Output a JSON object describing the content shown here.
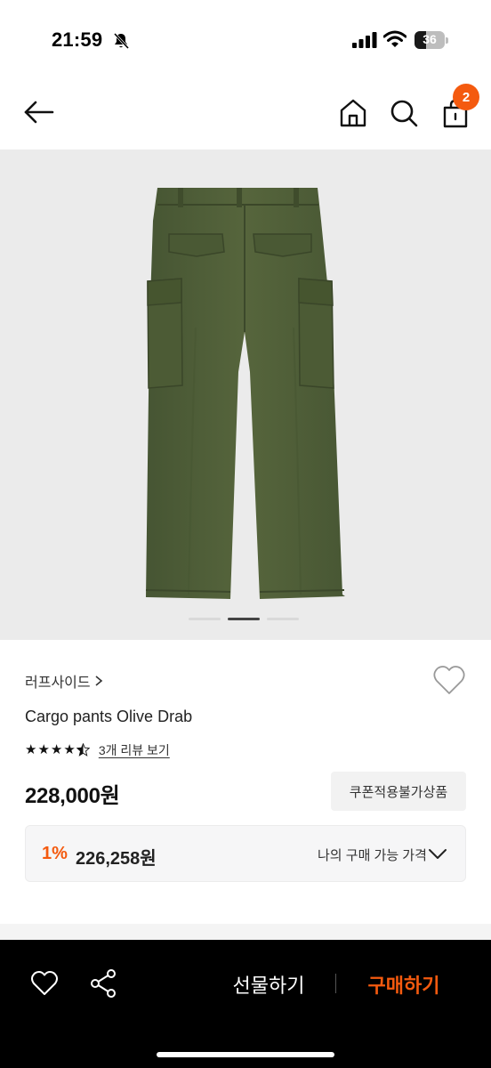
{
  "status_bar": {
    "time": "21:59",
    "battery": "36",
    "icons": [
      "bell-off-icon",
      "signal-icon",
      "wifi-icon",
      "battery-icon"
    ]
  },
  "nav": {
    "icons": [
      "back-arrow-icon",
      "home-icon",
      "search-icon",
      "shopping-bag-icon"
    ],
    "cart_count": "2"
  },
  "gallery": {
    "image": "olive cargo pants back view",
    "current_slide": 2,
    "total_slides": 3
  },
  "product": {
    "brand": "러프사이드",
    "name": "Cargo pants Olive Drab",
    "rating": 4.5,
    "review_link": "3개 리뷰 보기",
    "price": "228,000원",
    "coupon_badge": "쿠폰적용불가상품"
  },
  "my_price": {
    "discount": "1%",
    "amount": "226,258원",
    "label": "나의 구매 가능 가격"
  },
  "bottom_bar": {
    "gift_label": "선물하기",
    "buy_label": "구매하기"
  },
  "colors": {
    "accent": "#f45a0f",
    "bottom_bar_bg": "#000000",
    "gallery_bg": "#ebebeb",
    "pants": "#4f5e36"
  }
}
